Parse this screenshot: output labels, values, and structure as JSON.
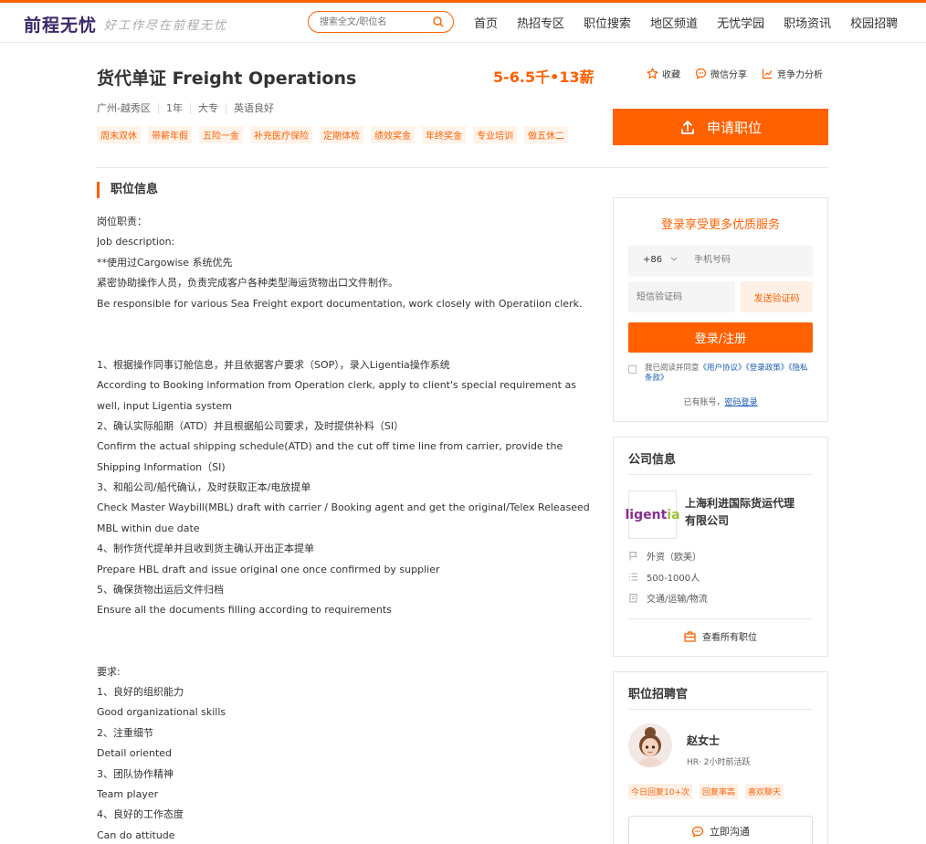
{
  "header": {
    "logo": "前程无忧",
    "slogan": "好工作尽在前程无忧",
    "search_placeholder": "搜索全文/职位名",
    "nav": [
      "首页",
      "热招专区",
      "职位搜索",
      "地区频道",
      "无忧学园",
      "职场资讯",
      "校园招聘"
    ]
  },
  "job": {
    "title": "货代单证 Freight Operations",
    "salary": "5-6.5千•13薪",
    "actions": [
      "收藏",
      "微信分享",
      "竞争力分析"
    ],
    "meta": [
      "广州-越秀区",
      "1年",
      "大专",
      "英语良好"
    ],
    "tags": [
      "周末双休",
      "带薪年假",
      "五险一金",
      "补充医疗保险",
      "定期体检",
      "绩效奖金",
      "年终奖金",
      "专业培训",
      "做五休二"
    ],
    "apply_label": "申请职位"
  },
  "section": {
    "title": "职位信息",
    "lines": [
      "岗位职责：",
      "Job description:",
      "**使用过Cargowise 系统优先",
      "紧密协助操作人员，负责完成客户各种类型海运货物出口文件制作。",
      "Be responsible for various Sea Freight export documentation, work closely with Operatiion clerk.",
      "",
      "",
      "1、根据操作同事订舱信息，并且依据客户要求（SOP），录入Ligentia操作系统",
      "According to Booking information from Operation clerk, apply to client's special requirement as",
      "well, input Ligentia system",
      "2、确认实际船期（ATD）并且根据船公司要求，及时提供补料（SI）",
      "Confirm the actual shipping schedule(ATD) and the cut off time line from carrier, provide the",
      "Shipping Information（SI)",
      "3、和船公司/船代确认，及时获取正本/电放提单",
      "Check Master Waybill(MBL) draft with carrier / Booking agent and get the original/Telex Releaseed",
      "MBL within due date",
      "4、制作货代提单并且收到货主确认开出正本提单",
      "Prepare HBL draft and issue original one once confirmed by supplier",
      "5、确保货物出运后文件归档",
      "Ensure all the documents filling according to requirements",
      "",
      "",
      "要求:",
      "1、良好的组织能力",
      "Good organizational skills",
      "2、注重细节",
      "Detail oriented",
      "3、团队协作精神",
      "Team player",
      "4、良好的工作态度",
      "Can do attitude"
    ]
  },
  "login": {
    "title": "登录享受更多优质服务",
    "country_code": "+86",
    "phone_placeholder": "手机号码",
    "code_placeholder": "短信验证码",
    "send_code": "发送验证码",
    "login_btn": "登录/注册",
    "agree_prefix": "我已阅读并同意",
    "agree_link1": "《用户协议》",
    "agree_link2": "《登录政策》",
    "agree_link3": "《隐私条款》",
    "have_account": "已有账号，",
    "password_login": "密码登录"
  },
  "company": {
    "heading": "公司信息",
    "logo_part1": "ligent",
    "logo_part2": "ia",
    "name": "上海利进国际货运代理有限公司",
    "type": "外资（欧美）",
    "size": "500-1000人",
    "industry": "交通/运输/物流",
    "view_all": "查看所有职位"
  },
  "recruiter": {
    "heading": "职位招聘官",
    "name": "赵女士",
    "status": "HR· 2小时前活跃",
    "tags": [
      "今日回复10+次",
      "回复率高",
      "喜欢聊天"
    ],
    "chat": "立即沟通"
  },
  "colors": {
    "accent": "#ff6000",
    "link": "#1a5bb5"
  }
}
